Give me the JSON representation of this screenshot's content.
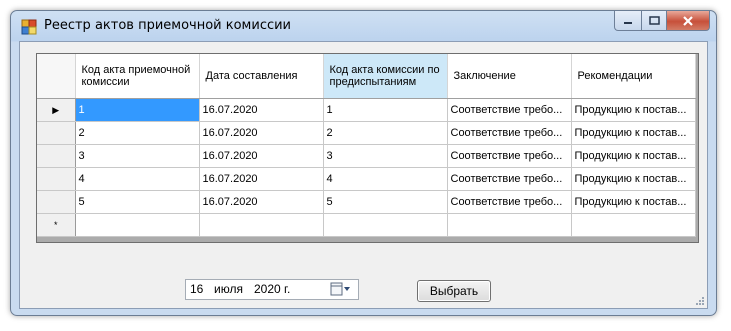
{
  "window": {
    "title": "Реестр актов приемочной комиссии"
  },
  "grid": {
    "columns": [
      "Код акта приемочной комиссии",
      "Дата составления",
      "Код акта комиссии по предиспытаниям",
      "Заключение",
      "Рекомендации"
    ],
    "rows": [
      [
        "1",
        "16.07.2020",
        "1",
        "Соответствие требо...",
        "Продукцию к постав..."
      ],
      [
        "2",
        "16.07.2020",
        "2",
        "Соответствие требо...",
        "Продукцию к постав..."
      ],
      [
        "3",
        "16.07.2020",
        "3",
        "Соответствие требо...",
        "Продукцию к постав..."
      ],
      [
        "4",
        "16.07.2020",
        "4",
        "Соответствие требо...",
        "Продукцию к постав..."
      ],
      [
        "5",
        "16.07.2020",
        "5",
        "Соответствие требо...",
        "Продукцию к постав..."
      ]
    ],
    "current_row_marker": "▶",
    "new_row_marker": "*"
  },
  "date_picker": {
    "day": "16",
    "month": "июля",
    "year": "2020 г."
  },
  "select_button": {
    "label": "Выбрать"
  }
}
